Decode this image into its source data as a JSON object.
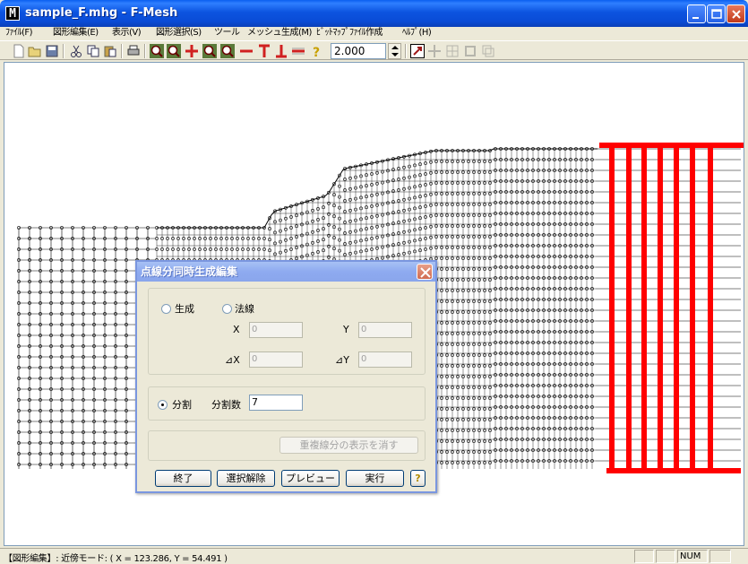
{
  "window": {
    "title": "sample_F.mhg - F-Mesh",
    "app_icon_letter": "M"
  },
  "menu": [
    "ﾌｧｲﾙ(F)",
    "図形編集(E)",
    "表示(V)",
    "図形選択(S)",
    "ツール",
    "メッシュ生成(M)",
    "ﾋﾞｯﾄﾏｯﾌﾟﾌｧｲﾙ作成",
    "ﾍﾙﾌﾟ(H)"
  ],
  "toolbar": {
    "zoom_value": "2.000"
  },
  "dialog": {
    "title": "点線分同時生成編集",
    "radio_generate": "生成",
    "radio_normal": "法線",
    "label_x": "X",
    "label_y": "Y",
    "label_dx": "⊿X",
    "label_dy": "⊿Y",
    "value_x": "0",
    "value_y": "0",
    "value_dx": "0",
    "value_dy": "0",
    "radio_divide": "分割",
    "label_divisions": "分割数",
    "value_divisions": "7",
    "btn_clear_duplicates": "重複線分の表示を消す",
    "btn_exit": "終了",
    "btn_deselect": "選択解除",
    "btn_preview": "プレビュー",
    "btn_execute": "実行",
    "help_glyph": "?"
  },
  "statusbar": {
    "text": "【図形編集】: 近傍モード: ( X = 123.286, Y = 54.491 )",
    "num": "NUM"
  },
  "colors": {
    "mesh_line": "#000000",
    "selected": "#ff0000",
    "title_blue": "#0a4bd6"
  }
}
